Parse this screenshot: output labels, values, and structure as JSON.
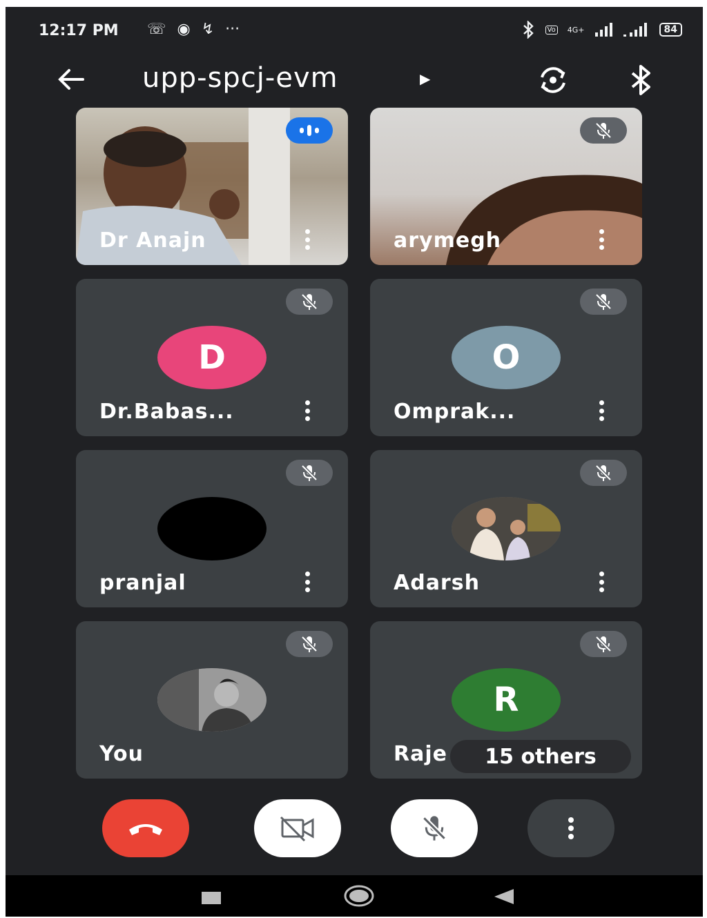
{
  "status_bar": {
    "time": "12:17 PM",
    "network": "4G+",
    "battery": "84"
  },
  "header": {
    "meeting_code": "upp-spcj-evm"
  },
  "participants": [
    {
      "name": "Dr Anajn",
      "state": "speaking",
      "tile": "video"
    },
    {
      "name": "arymegh",
      "state": "muted",
      "tile": "video"
    },
    {
      "name": "Dr.Babas...",
      "state": "muted",
      "tile": "avatar",
      "initial": "D",
      "color": "#e8457a"
    },
    {
      "name": "Omprak...",
      "state": "muted",
      "tile": "avatar",
      "initial": "O",
      "color": "#7e9aa8"
    },
    {
      "name": "pranjal",
      "state": "muted",
      "tile": "avatar",
      "initial": "",
      "color": "#000000"
    },
    {
      "name": "Adarsh",
      "state": "muted",
      "tile": "photo"
    },
    {
      "name": "You",
      "state": "muted",
      "tile": "photo"
    },
    {
      "name": "Raje",
      "state": "muted",
      "tile": "avatar",
      "initial": "R",
      "color": "#2e7d32"
    }
  ],
  "others_badge": "15 others",
  "colors": {
    "background": "#202124",
    "tile": "#3c4043",
    "end_call": "#ea4335",
    "speaking": "#1a73e8"
  },
  "icons": {
    "back": "arrow-left-icon",
    "switch_camera": "camera-switch-icon",
    "audio_output": "bluetooth-icon",
    "end_call": "phone-hangup-icon",
    "camera": "video-off-icon",
    "microphone": "mic-off-icon",
    "more": "more-vert-icon"
  }
}
